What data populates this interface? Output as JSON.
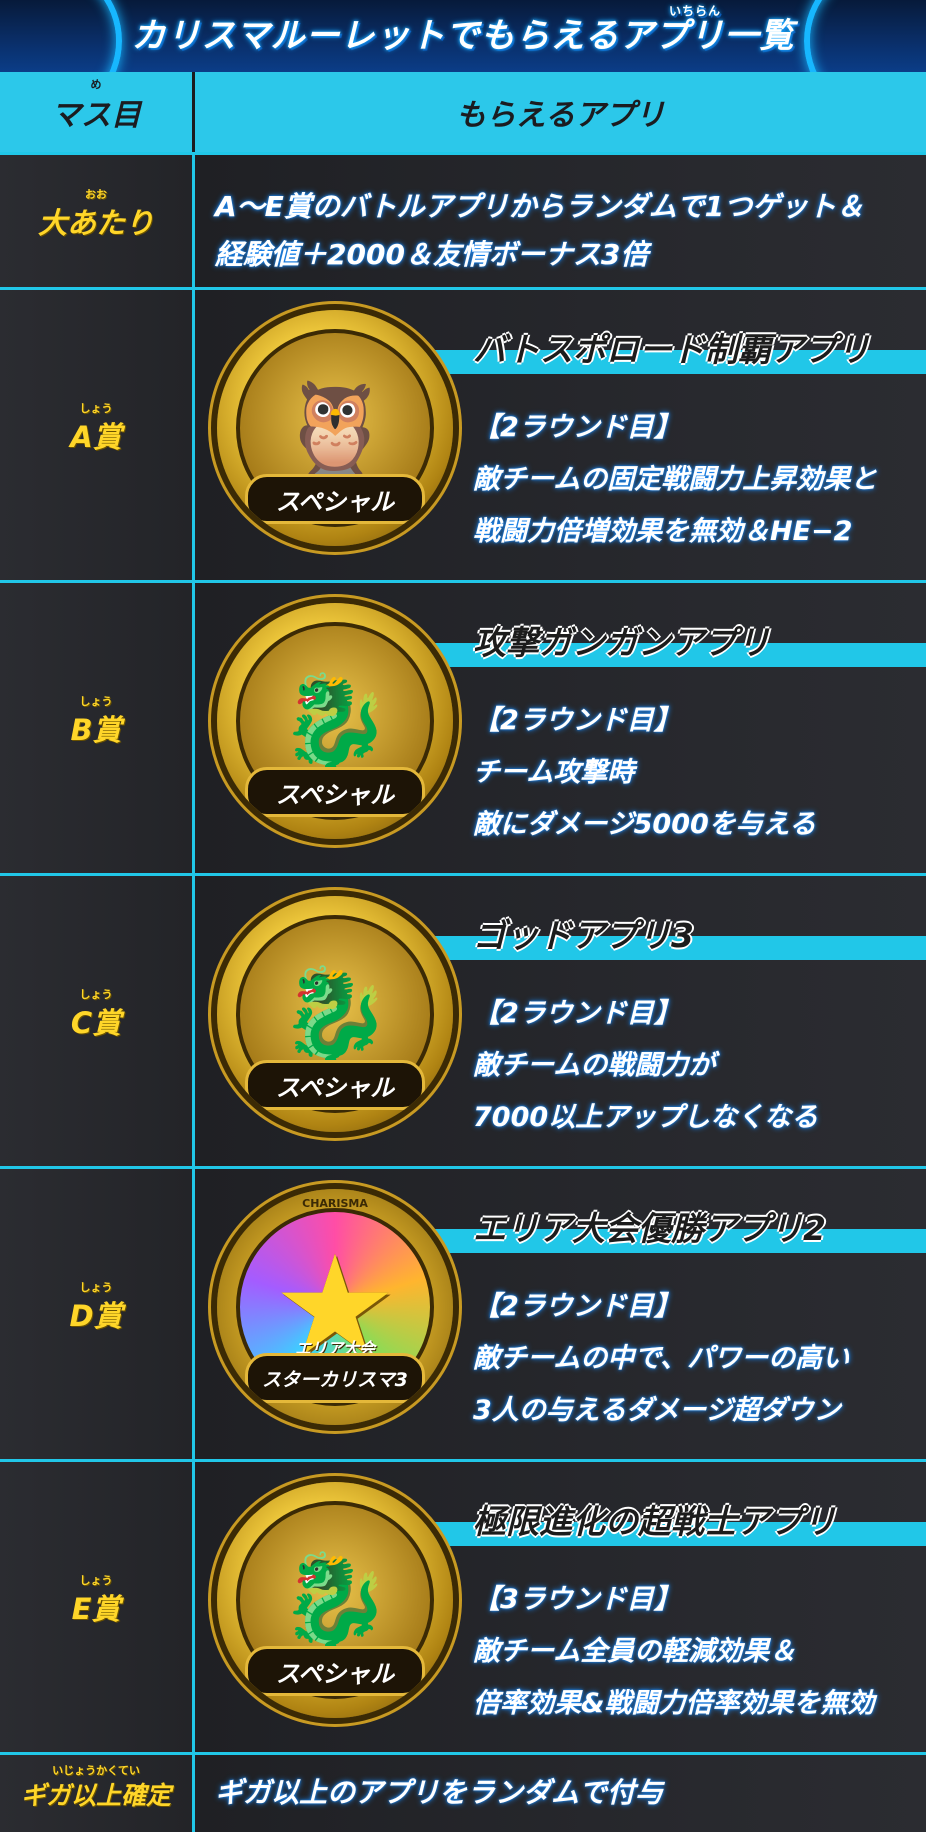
{
  "header": {
    "title": "カリスマルーレットでもらえるアプリ一覧",
    "title_ruby": "いちらん"
  },
  "table": {
    "col_left_header": "マス目",
    "col_left_header_ruby": "め",
    "col_right_header": "もらえるアプリ"
  },
  "jackpot": {
    "label": "大あたり",
    "label_ruby": "おお",
    "line1": "A～E賞のバトルアプリからランダムで1つゲット＆",
    "line2": "経験値＋2000＆友情ボーナス3倍"
  },
  "prizes": [
    {
      "label": "A賞",
      "label_ruby": "しょう",
      "app_name": "バトスポロード制覇アプリ",
      "effect_lines": [
        "【2ラウンド目】",
        "敵チームの固定戦闘力上昇効果と",
        "戦闘力倍増効果を無効＆HE−2"
      ],
      "medal_text": "スペシャル",
      "medal_icon": "owl-icon"
    },
    {
      "label": "B賞",
      "label_ruby": "しょう",
      "app_name": "攻撃ガンガンアプリ",
      "effect_lines": [
        "【2ラウンド目】",
        "チーム攻撃時",
        "敵にダメージ5000を与える"
      ],
      "medal_text": "スペシャル",
      "medal_icon": "dragon-icon"
    },
    {
      "label": "C賞",
      "label_ruby": "しょう",
      "app_name": "ゴッドアプリ3",
      "effect_lines": [
        "【2ラウンド目】",
        "敵チームの戦闘力が",
        "7000以上アップしなくなる"
      ],
      "medal_text": "スペシャル",
      "medal_icon": "dragon-icon"
    },
    {
      "label": "D賞",
      "label_ruby": "しょう",
      "app_name": "エリア大会優勝アプリ2",
      "effect_lines": [
        "【2ラウンド目】",
        "敵チームの中で、パワーの高い",
        "3人の与えるダメージ超ダウン"
      ],
      "medal_text": "スターカリスマ3",
      "medal_top": "CHARISMA",
      "medal_sub": "エリア大会",
      "medal_icon": "star-icon"
    },
    {
      "label": "E賞",
      "label_ruby": "しょう",
      "app_name": "極限進化の超戦士アプリ",
      "effect_lines": [
        "【3ラウンド目】",
        "敵チーム全員の軽減効果＆",
        "倍率効果&戦闘力倍率効果を無効"
      ],
      "medal_text": "スペシャル",
      "medal_icon": "dragon-icon"
    }
  ],
  "giga": {
    "label": "ギガ以上確定",
    "label_ruby": "いじょうかくてい",
    "desc": "ギガ以上のアプリをランダムで付与"
  }
}
